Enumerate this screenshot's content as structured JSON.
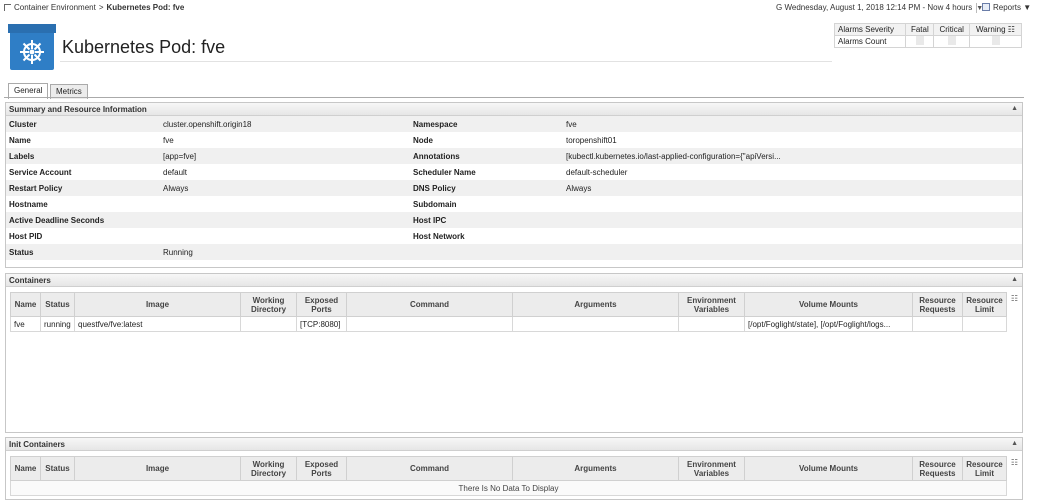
{
  "breadcrumb": {
    "parent": "Container Environment",
    "separator": ">",
    "current": "Kubernetes Pod: fve"
  },
  "time_range": {
    "icon": "G",
    "text": "Wednesday, August 1, 2018 12:14 PM - Now 4 hours",
    "arrow": "▼"
  },
  "reports": {
    "label": "Reports",
    "arrow": "▼"
  },
  "page_title": "Kubernetes Pod: fve",
  "alarms": {
    "severity_label": "Alarms Severity",
    "count_label": "Alarms Count",
    "columns": [
      "Fatal",
      "Critical",
      "Warning"
    ]
  },
  "tabs": [
    {
      "label": "General",
      "active": true
    },
    {
      "label": "Metrics",
      "active": false
    }
  ],
  "summary": {
    "title": "Summary and Resource Information",
    "rows": [
      {
        "k1": "Cluster",
        "v1": "cluster.openshift.origin18",
        "k2": "Namespace",
        "v2": "fve"
      },
      {
        "k1": "Name",
        "v1": "fve",
        "k2": "Node",
        "v2": "toropenshift01"
      },
      {
        "k1": "Labels",
        "v1": "[app=fve]",
        "k2": "Annotations",
        "v2": "[kubectl.kubernetes.io/last-applied-configuration={\"apiVersi..."
      },
      {
        "k1": "Service Account",
        "v1": "default",
        "k2": "Scheduler Name",
        "v2": "default-scheduler"
      },
      {
        "k1": "Restart Policy",
        "v1": "Always",
        "k2": "DNS Policy",
        "v2": "Always"
      },
      {
        "k1": "Hostname",
        "v1": "",
        "k2": "Subdomain",
        "v2": ""
      },
      {
        "k1": "Active Deadline Seconds",
        "v1": "",
        "k2": "Host IPC",
        "v2": ""
      },
      {
        "k1": "Host PID",
        "v1": "",
        "k2": "Host Network",
        "v2": ""
      },
      {
        "k1": "Status",
        "v1": "Running",
        "k2": "",
        "v2": ""
      }
    ]
  },
  "containers": {
    "title": "Containers",
    "headers": [
      "Name",
      "Status",
      "Image",
      "Working Directory",
      "Exposed Ports",
      "Command",
      "Arguments",
      "Environment Variables",
      "Volume Mounts",
      "Resource Requests",
      "Resource Limit"
    ],
    "rows": [
      [
        "fve",
        "running",
        "questfve/fve:latest",
        "",
        "[TCP:8080]",
        "",
        "",
        "",
        "[/opt/Foglight/state], [/opt/Foglight/logs...",
        "",
        ""
      ]
    ]
  },
  "init_containers": {
    "title": "Init Containers",
    "headers": [
      "Name",
      "Status",
      "Image",
      "Working Directory",
      "Exposed Ports",
      "Command",
      "Arguments",
      "Environment Variables",
      "Volume Mounts",
      "Resource Requests",
      "Resource Limit"
    ],
    "empty_text": "There Is No Data To Display"
  }
}
